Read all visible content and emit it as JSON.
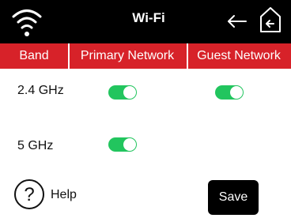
{
  "header": {
    "title": "Wi-Fi",
    "status_icon": "wifi-icon",
    "back_icon": "back-arrow-icon",
    "home_icon": "home-icon"
  },
  "table": {
    "columns": [
      "Band",
      "Primary Network",
      "Guest Network"
    ],
    "rows": [
      {
        "band": "2.4 GHz",
        "primary": "on",
        "guest": "on"
      },
      {
        "band": "5 GHz",
        "primary": "on",
        "guest": null
      }
    ]
  },
  "footer": {
    "help_label": "Help",
    "help_icon": "question-circle-icon",
    "save_label": "Save"
  },
  "colors": {
    "header_bg": "#000000",
    "column_bar_bg": "#d72229",
    "toggle_on": "#22c55e",
    "save_bg": "#000000"
  }
}
